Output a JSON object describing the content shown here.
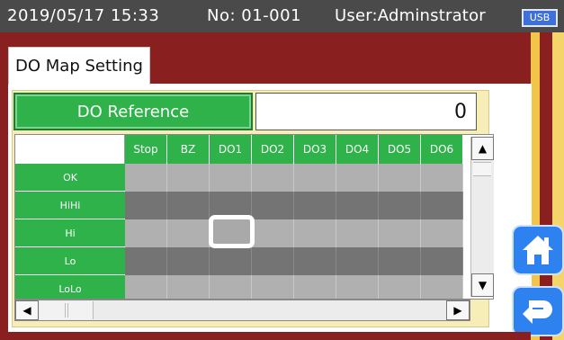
{
  "statusbar": {
    "datetime": "2019/05/17 15:33",
    "number": "No: 01-001",
    "user": "User:Adminstrator",
    "usb": "USB"
  },
  "tab": {
    "label": "DO Map Setting"
  },
  "reference": {
    "button_label": "DO Reference",
    "value": "0"
  },
  "grid": {
    "columns": [
      "Stop",
      "BZ",
      "DO1",
      "DO2",
      "DO3",
      "DO4",
      "DO5",
      "DO6"
    ],
    "rows": [
      "OK",
      "HiHi",
      "Hi",
      "Lo",
      "LoLo"
    ]
  },
  "colors": {
    "accent_green": "#2fb24a",
    "frame_red": "#8a1f1f",
    "panel_yellow": "#f6edb7",
    "button_blue": "#2e82f0"
  },
  "icons": {
    "scroll_up": "▲",
    "scroll_down": "▼",
    "scroll_left": "◀",
    "scroll_right": "▶"
  }
}
